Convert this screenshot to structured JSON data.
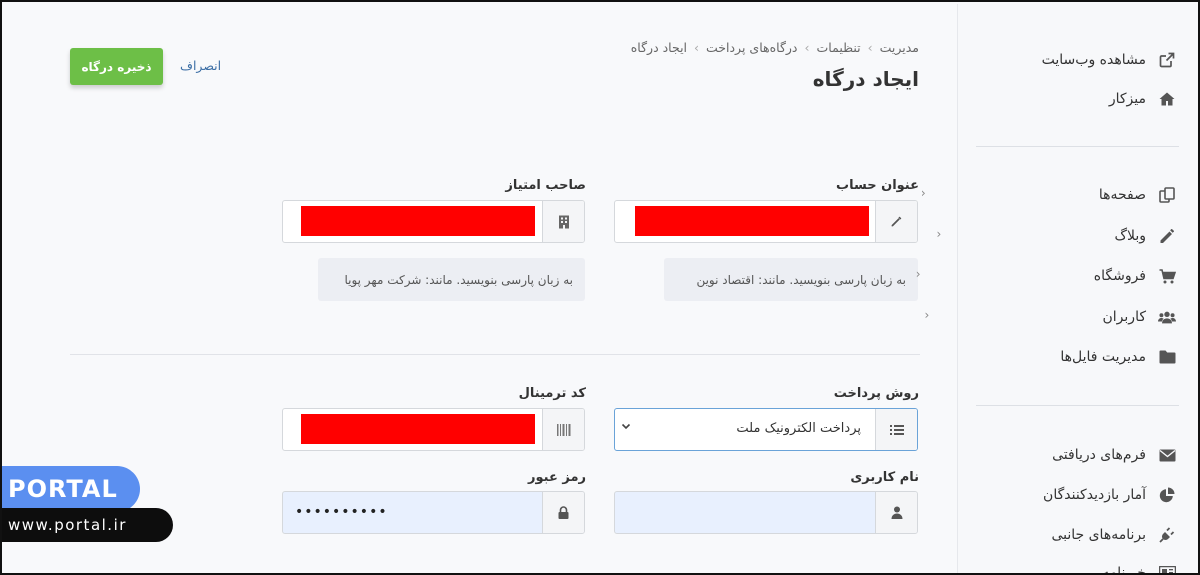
{
  "breadcrumb": [
    "مدیریت",
    "تنظیمات",
    "درگاه‌های پرداخت",
    "ایجاد درگاه"
  ],
  "page_title": "ایجاد درگاه",
  "actions": {
    "save_label": "ذخیره درگاه",
    "cancel_label": "انصراف"
  },
  "form": {
    "account_title": {
      "label": "عنوان حساب",
      "hint": "به زبان پارسی بنویسید. مانند: اقتصاد نوین"
    },
    "license_owner": {
      "label": "صاحب امتیاز",
      "hint": "به زبان پارسی بنویسید. مانند: شرکت مهر پویا"
    },
    "payment_method": {
      "label": "روش پرداخت",
      "value": "پرداخت الکترونیک ملت"
    },
    "terminal_code": {
      "label": "کد ترمینال"
    },
    "username": {
      "label": "نام کاربری"
    },
    "password": {
      "label": "رمز عبور",
      "value": "••••••••••"
    }
  },
  "sidebar": {
    "top": [
      {
        "label": "مشاهده وب‌سایت",
        "icon": "external-link-icon"
      },
      {
        "label": "میزکار",
        "icon": "home-icon"
      }
    ],
    "content": [
      {
        "label": "صفحه‌ها",
        "icon": "pages-icon"
      },
      {
        "label": "وبلاگ",
        "icon": "pencil-icon"
      },
      {
        "label": "فروشگاه",
        "icon": "cart-icon"
      },
      {
        "label": "کاربران",
        "icon": "users-icon"
      },
      {
        "label": "مدیریت فایل‌ها",
        "icon": "folder-icon"
      }
    ],
    "tools": [
      {
        "label": "فرم‌های دریافتی",
        "icon": "envelope-icon"
      },
      {
        "label": "آمار بازدیدکنندگان",
        "icon": "pie-chart-icon"
      },
      {
        "label": "برنامه‌های جانبی",
        "icon": "plug-icon"
      },
      {
        "label": "خبرنامه",
        "icon": "newsletter-icon"
      }
    ]
  },
  "watermark": {
    "brand": "PORTAL",
    "url": "www.portal.ir"
  },
  "colors": {
    "save_button": "#6dbf47",
    "redaction": "#ff0000",
    "watermark_badge": "#5b8ff0",
    "link": "#3b6ea5"
  }
}
